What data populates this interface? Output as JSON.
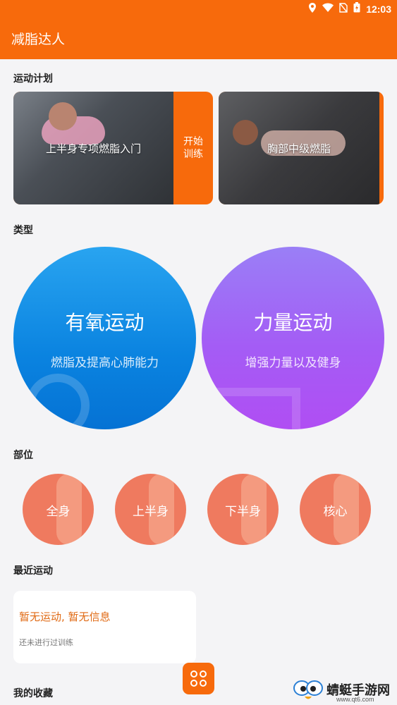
{
  "status_bar": {
    "time": "12:03"
  },
  "app_bar": {
    "title": "减脂达人"
  },
  "sections": {
    "plan": "运动计划",
    "type": "类型",
    "parts": "部位",
    "recent": "最近运动",
    "favorites": "我的收藏"
  },
  "plans": [
    {
      "title": "上半身专项燃脂入门",
      "action": "开始训练"
    },
    {
      "title": "胸部中级燃脂"
    }
  ],
  "types": [
    {
      "title": "有氧运动",
      "subtitle": "燃脂及提高心肺能力",
      "color": "#0a83e0"
    },
    {
      "title": "力量运动",
      "subtitle": "增强力量以及健身",
      "color": "#a45cf5"
    }
  ],
  "parts": [
    {
      "label": "全身"
    },
    {
      "label": "上半身"
    },
    {
      "label": "下半身"
    },
    {
      "label": "核心"
    }
  ],
  "recent": {
    "headline": "暂无运动, 暂无信息",
    "hint": "还未进行过训练"
  },
  "watermark": {
    "name": "蜻蜓手游网",
    "url": "www.qt6.com"
  },
  "colors": {
    "accent": "#f76a0c",
    "background": "#f4f4f6",
    "part": "#ef7a5f"
  }
}
